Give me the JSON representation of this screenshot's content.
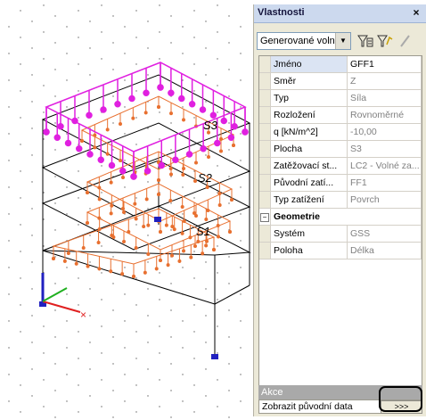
{
  "panel": {
    "title": "Vlastnosti",
    "close": "×",
    "filter_value": "Generované volné",
    "rows": [
      {
        "name": "Jméno",
        "value": "GFF1"
      },
      {
        "name": "Směr",
        "value": "Z"
      },
      {
        "name": "Typ",
        "value": "Síla"
      },
      {
        "name": "Rozložení",
        "value": "Rovnoměrné"
      },
      {
        "name": "q [kN/m^2]",
        "value": "-10,00"
      },
      {
        "name": "Plocha",
        "value": "S3"
      },
      {
        "name": "Zatěžovací st...",
        "value": "LC2 - Volné za..."
      },
      {
        "name": "Původní zatí...",
        "value": "FF1"
      },
      {
        "name": "Typ zatížení",
        "value": "Povrch"
      }
    ],
    "section": {
      "label": "Geometrie",
      "toggle": "−"
    },
    "geo_rows": [
      {
        "name": "Systém",
        "value": "GSS"
      },
      {
        "name": "Poloha",
        "value": "Délka"
      }
    ],
    "actions_header": "Akce",
    "action_label": "Zobrazit původní data",
    "action_button": ">>>"
  },
  "scene": {
    "surface_labels": [
      "S3",
      "S2",
      "S1"
    ],
    "colors": {
      "load_generated": "#e020e0",
      "load_free": "#e87030",
      "frame": "#000000",
      "axis_x": "#e02020",
      "axis_y": "#20b020",
      "axis_z": "#2020c0"
    }
  }
}
